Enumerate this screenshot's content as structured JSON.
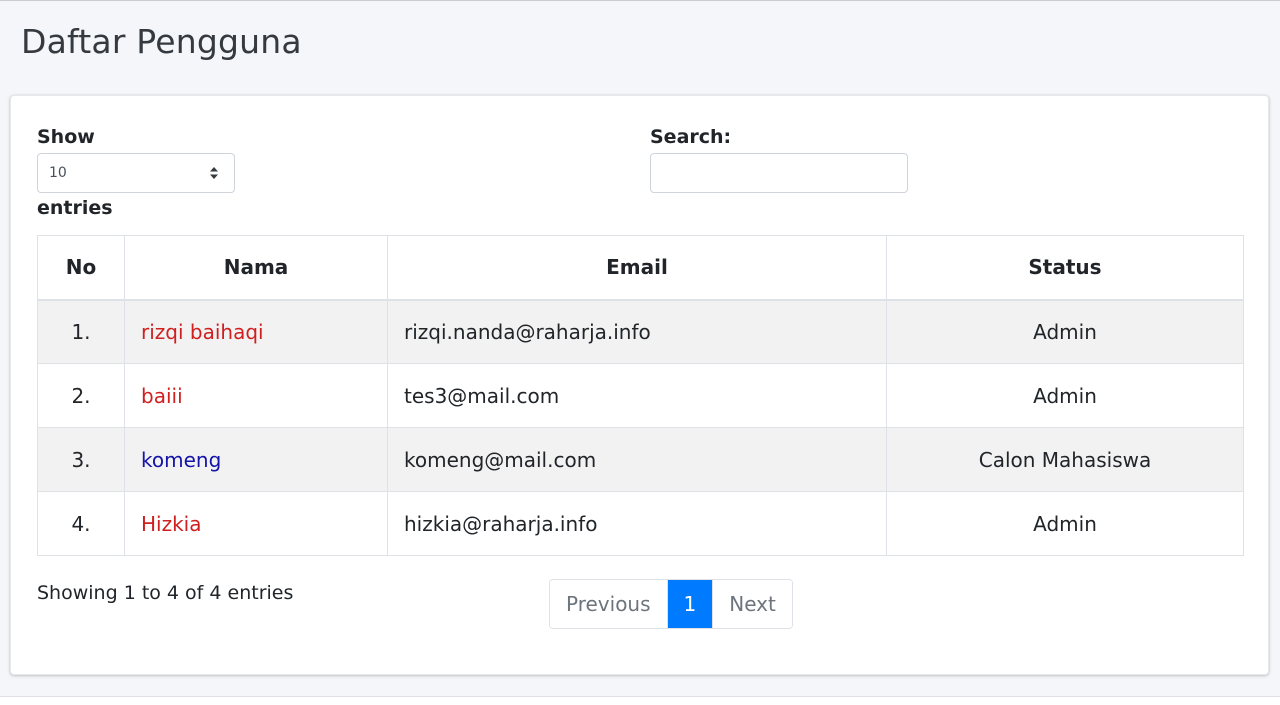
{
  "page": {
    "title": "Daftar Pengguna"
  },
  "controls": {
    "show_label": "Show",
    "entries_label": "entries",
    "length_value": "10",
    "search_label": "Search:",
    "search_value": ""
  },
  "table": {
    "headers": [
      "No",
      "Nama",
      "Email",
      "Status"
    ],
    "rows": [
      {
        "no": "1.",
        "nama": "rizqi baihaqi",
        "email": "rizqi.nanda@raharja.info",
        "status": "Admin",
        "name_color": "#d01f1f"
      },
      {
        "no": "2.",
        "nama": "baiii",
        "email": "tes3@mail.com",
        "status": "Admin",
        "name_color": "#d01f1f"
      },
      {
        "no": "3.",
        "nama": "komeng",
        "email": "komeng@mail.com",
        "status": "Calon Mahasiswa",
        "name_color": "#1414a8"
      },
      {
        "no": "4.",
        "nama": "Hizkia",
        "email": "hizkia@raharja.info",
        "status": "Admin",
        "name_color": "#d01f1f"
      }
    ]
  },
  "footer": {
    "info": "Showing 1 to 4 of 4 entries",
    "previous_label": "Previous",
    "current_page": "1",
    "next_label": "Next"
  },
  "colors": {
    "accent": "#007bff",
    "admin_name": "#d01f1f",
    "student_name": "#1414a8"
  },
  "icons": {
    "select_caret": "sort-caret-icon"
  }
}
